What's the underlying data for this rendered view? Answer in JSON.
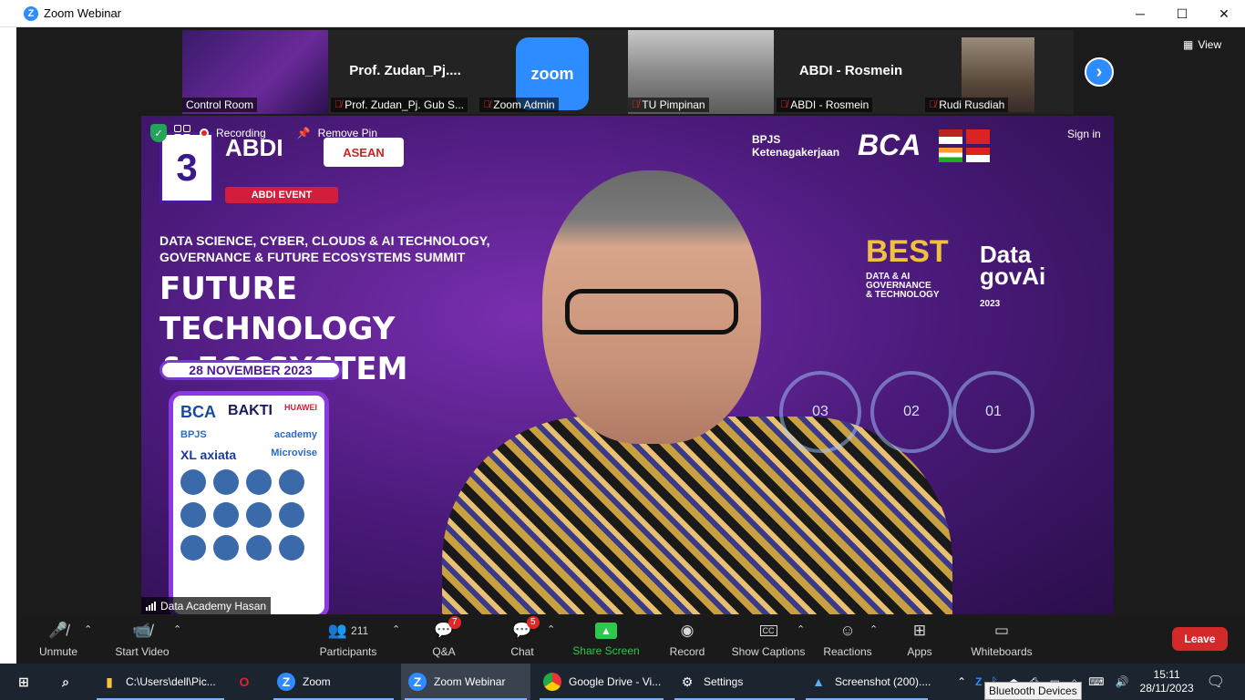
{
  "window": {
    "title": "Zoom Webinar",
    "minimize": "─",
    "maximize": "☐",
    "close": "✕"
  },
  "thumbnails": [
    {
      "label": "Control Room",
      "muted": false,
      "big_name": ""
    },
    {
      "label": "Prof. Zudan_Pj. Gub S...",
      "muted": true,
      "big_name": "Prof.  Zudan_Pj...."
    },
    {
      "label": "Zoom Admin",
      "muted": true,
      "big_name": "",
      "logo_text": "zoom"
    },
    {
      "label": "TU Pimpinan",
      "muted": true,
      "big_name": ""
    },
    {
      "label": "ABDI - Rosmein",
      "muted": true,
      "big_name": "ABDI - Rosmein"
    },
    {
      "label": "Rudi Rusdiah",
      "muted": true,
      "big_name": ""
    }
  ],
  "view_button": "View",
  "overlay": {
    "recording": "Recording",
    "remove_pin": "Remove Pin",
    "sign_in": "Sign in"
  },
  "main_video": {
    "speaker_label": "Data Academy Hasan",
    "day_badge": "3",
    "abdi": "ABDI",
    "asean": "ASEAN",
    "abdi_event": "ABDI EVENT",
    "summit_line1": "DATA SCIENCE, CYBER, CLOUDS & AI TECHNOLOGY,",
    "summit_line2": "GOVERNANCE & FUTURE ECOSYSTEMS SUMMIT",
    "future_line1": "FUTURE TECHNOLOGY",
    "future_line2": "& ECOSYSTEM",
    "date": "28 NOVEMBER 2023",
    "sponsors": {
      "bca": "BCA",
      "bakti": "BAKTI",
      "huawei": "HUAWEI",
      "xl": "XL axiata",
      "micro": "Microvise",
      "academy": "academy"
    },
    "bpjs_line1": "BPJS",
    "bpjs_line2": "Ketenagakerjaan",
    "bca_right": "BCA",
    "best": "BEST",
    "best_sub1": "DATA & AI",
    "best_sub2": "GOVERNANCE",
    "best_sub3": "& TECHNOLOGY",
    "datagov_line1": "Data",
    "datagov_line2": "govAi",
    "datagov_year": "2023",
    "rings": [
      "03",
      "02",
      "01"
    ]
  },
  "toolbar": {
    "unmute": "Unmute",
    "start_video": "Start Video",
    "participants": "Participants",
    "participants_count": "211",
    "qa": "Q&A",
    "qa_badge": "7",
    "chat": "Chat",
    "chat_badge": "5",
    "share_screen": "Share Screen",
    "record": "Record",
    "show_captions": "Show Captions",
    "reactions": "Reactions",
    "apps": "Apps",
    "whiteboards": "Whiteboards",
    "leave": "Leave"
  },
  "taskbar": {
    "explorer": "C:\\Users\\dell\\Pic...",
    "zoom": "Zoom",
    "zoom_webinar": "Zoom Webinar",
    "chrome": "Google Drive - Vi...",
    "settings": "Settings",
    "screenshot": "Screenshot (200)....",
    "time": "15:11",
    "date": "28/11/2023",
    "tooltip": "Bluetooth Devices"
  }
}
